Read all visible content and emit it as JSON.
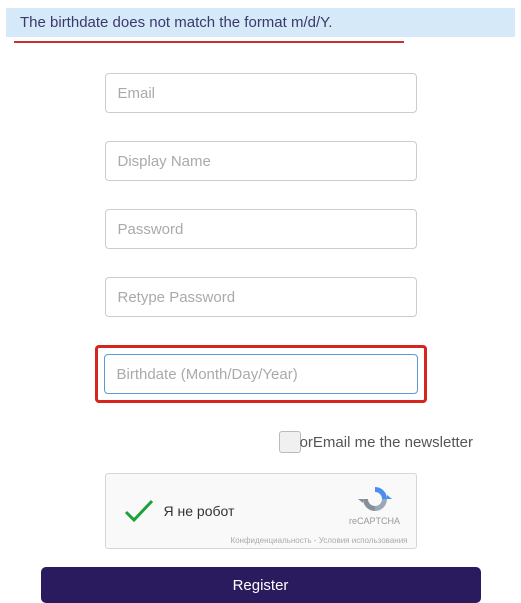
{
  "error": {
    "message": "The birthdate does not match the format m/d/Y."
  },
  "fields": {
    "email": {
      "placeholder": "Email"
    },
    "display_name": {
      "placeholder": "Display Name"
    },
    "password": {
      "placeholder": "Password"
    },
    "retype_password": {
      "placeholder": "Retype Password"
    },
    "birthdate": {
      "placeholder": "Birthdate (Month/Day/Year)"
    }
  },
  "newsletter": {
    "overlap_prefix": "or",
    "label": "Email me the newsletter"
  },
  "recaptcha": {
    "text": "Я не робот",
    "brand": "reCAPTCHA",
    "privacy": "Конфиденциальность - Условия использования"
  },
  "buttons": {
    "register": "Register"
  }
}
